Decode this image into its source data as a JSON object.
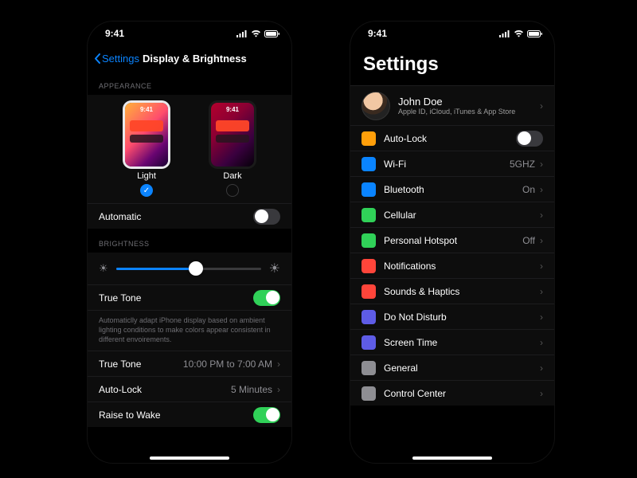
{
  "status_time": "9:41",
  "left": {
    "back_label": "Settings",
    "title": "Display & Brightness",
    "appearance_header": "Appearance",
    "mini_time": "9:41",
    "light_label": "Light",
    "dark_label": "Dark",
    "automatic_label": "Automatic",
    "brightness_header": "Brightness",
    "true_tone_label": "True Tone",
    "true_tone_footer": "Automaticlly adapt iPhone display based on ambient lighting conditions to make colors appear consistent in different envoirements.",
    "schedule_label": "True Tone",
    "schedule_value": "10:00 PM to 7:00 AM",
    "auto_lock_label": "Auto-Lock",
    "auto_lock_value": "5 Minutes",
    "raise_to_wake_label": "Raise to Wake"
  },
  "right": {
    "title": "Settings",
    "profile_name": "John Doe",
    "profile_sub": "Apple ID, iCloud, iTunes & App Store",
    "items": {
      "auto_lock": "Auto-Lock",
      "wifi": "Wi-Fi",
      "wifi_value": "5GHZ",
      "bluetooth": "Bluetooth",
      "bluetooth_value": "On",
      "cellular": "Cellular",
      "hotspot": "Personal Hotspot",
      "hotspot_value": "Off",
      "notifications": "Notifications",
      "sounds": "Sounds & Haptics",
      "dnd": "Do Not Disturb",
      "screen_time": "Screen Time",
      "general": "General",
      "control_center": "Control Center"
    },
    "colors": {
      "auto_lock": "#ff9f0a",
      "wifi": "#0a84ff",
      "bluetooth": "#0a84ff",
      "cellular": "#30d158",
      "hotspot": "#30d158",
      "notifications": "#ff453a",
      "sounds": "#ff453a",
      "dnd": "#5e5ce6",
      "screen_time": "#5e5ce6",
      "general": "#8e8e93",
      "control_center": "#8e8e93"
    }
  }
}
